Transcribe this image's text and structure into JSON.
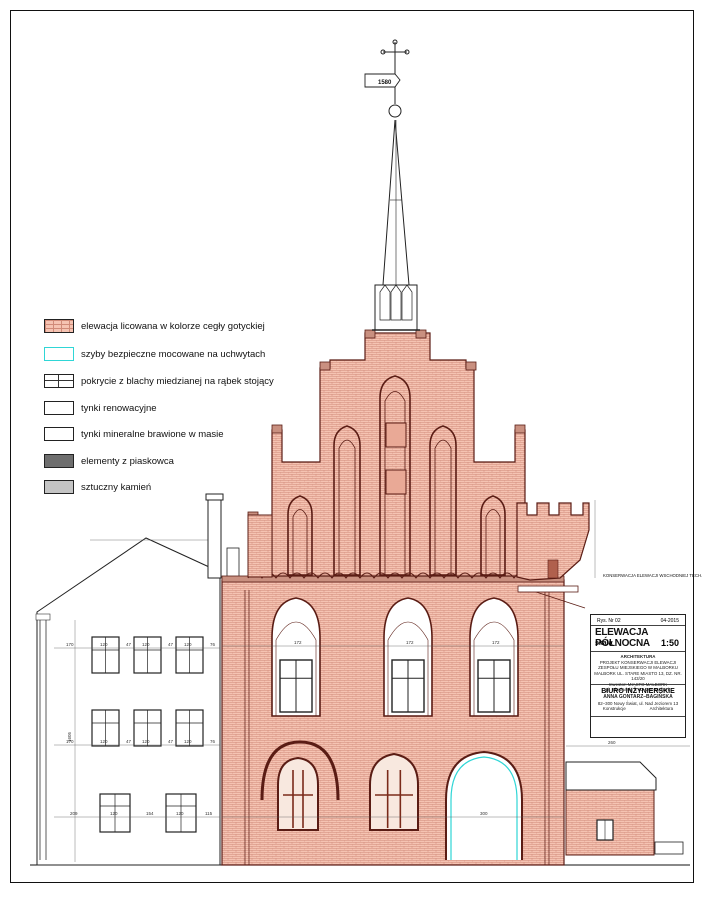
{
  "legend": {
    "items": [
      {
        "label": "elewacja licowana w kolorze cegły gotyckiej",
        "swatch": "brick"
      },
      {
        "label": "szyby bezpieczne mocowane na uchwytach",
        "swatch": "glass"
      },
      {
        "label": "pokrycie z blachy miedzianej na rąbek stojący",
        "swatch": "copper"
      },
      {
        "label": "tynki renowacyjne",
        "swatch": "render"
      },
      {
        "label": "tynki mineralne brawione w masie",
        "swatch": "mineral"
      },
      {
        "label": "elementy z piaskowca",
        "swatch": "sandstone"
      },
      {
        "label": "sztuczny kamień",
        "swatch": "stone"
      }
    ]
  },
  "title_block": {
    "drawing_no": "Rys. Nr 02",
    "date": "04-2015",
    "title": "ELEWACJA PÓŁNOCNA",
    "scale_label": "skala",
    "scale": "1:50",
    "discipline": "ARCHITEKTURA",
    "project_line1": "PROJEKT KONSERWACJI ELEWACJI",
    "project_line2": "ZESPOŁU MIEJSKIEGO W MALBORKU",
    "address": "MALBORK UL. STARE MIASTO 13, DZ. NR. 143/20",
    "investor": "Inwestor: MIASTO MALBORK",
    "investor_address": "pl. Słowiański 5, 82–200 Malbork",
    "office": "BIURO INŻYNIERSKIE",
    "office_name": "ANNA GONTARZ–BAGIŃSKA",
    "office_address": "82–300 Nowy Świat, ul. Nad Jeziorem 13",
    "col1": "Konstrukcje",
    "col2": "Architektura"
  },
  "note": "KONSERWACJA ELEWACJI WSCHODNIEJ TECH.",
  "vane_year": "1580",
  "colors": {
    "brick": "#f5c3b2",
    "mortar": "#d08a78",
    "outline": "#5a1c14",
    "wood": "#7a2a1a",
    "glass": "#2fd6d6",
    "dim": "#333333"
  },
  "dimensions": {
    "left_row_a": [
      "170",
      "120",
      "47",
      "120",
      "47",
      "120",
      "76"
    ],
    "left_row_b": [
      "170",
      "120",
      "47",
      "120",
      "47",
      "120",
      "76"
    ],
    "left_row_c": [
      "209",
      "120",
      "154",
      "120",
      "115"
    ],
    "main_row_a": [
      "172",
      "172",
      "172"
    ],
    "main_row_b": [
      "300"
    ],
    "left_height": "1605",
    "right_top": "260"
  }
}
